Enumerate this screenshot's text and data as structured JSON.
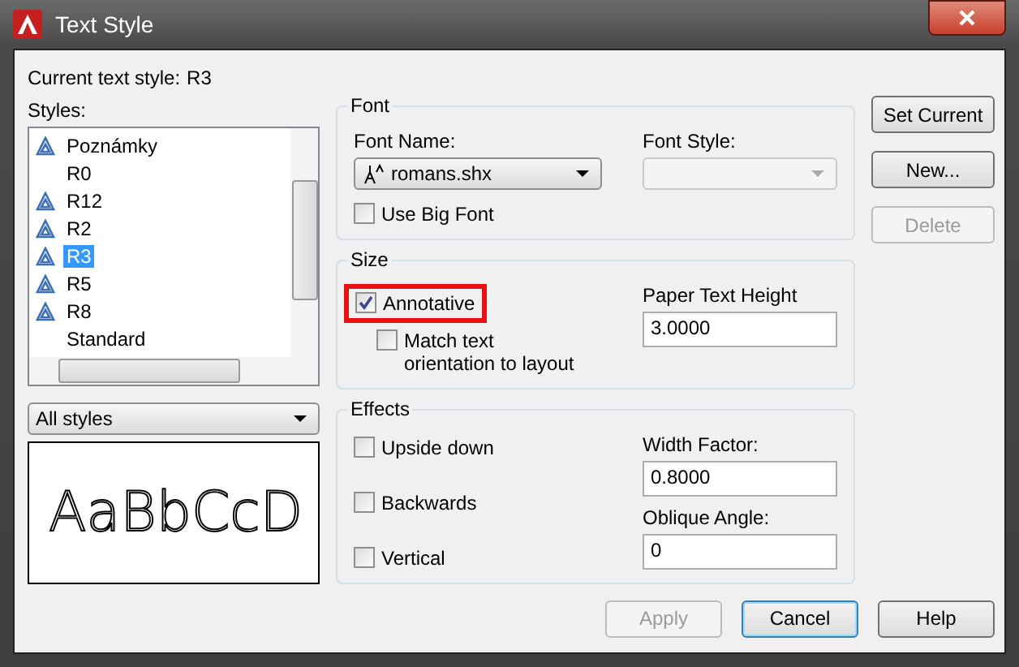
{
  "window": {
    "title": "Text Style"
  },
  "current_style": {
    "label": "Current text style:",
    "value": "R3"
  },
  "styles": {
    "label": "Styles:",
    "items": [
      {
        "name": "Poznámky",
        "annotative": true,
        "selected": false
      },
      {
        "name": "R0",
        "annotative": false,
        "selected": false
      },
      {
        "name": "R12",
        "annotative": true,
        "selected": false
      },
      {
        "name": "R2",
        "annotative": true,
        "selected": false
      },
      {
        "name": "R3",
        "annotative": true,
        "selected": true
      },
      {
        "name": "R5",
        "annotative": true,
        "selected": false
      },
      {
        "name": "R8",
        "annotative": true,
        "selected": false
      },
      {
        "name": "Standard",
        "annotative": false,
        "selected": false
      }
    ]
  },
  "filter": {
    "value": "All styles"
  },
  "preview": {
    "text": "AaBbCcD"
  },
  "font": {
    "title": "Font",
    "font_name": {
      "label": "Font Name:",
      "value": "romans.shx"
    },
    "font_style": {
      "label": "Font Style:",
      "disabled": true
    },
    "big_font": {
      "label": "Use Big Font",
      "checked": false
    }
  },
  "size": {
    "title": "Size",
    "annotative": {
      "label": "Annotative",
      "checked": true,
      "highlighted": true
    },
    "match": {
      "label": "Match text orientation to layout",
      "checked": false
    },
    "height": {
      "label": "Paper Text Height",
      "value": "3.0000"
    }
  },
  "effects": {
    "title": "Effects",
    "checks": [
      {
        "label": "Upside down",
        "checked": false
      },
      {
        "label": "Backwards",
        "checked": false
      },
      {
        "label": "Vertical",
        "checked": false
      }
    ],
    "width_factor": {
      "label": "Width Factor:",
      "value": "0.8000"
    },
    "oblique": {
      "label": "Oblique Angle:",
      "value": "0"
    }
  },
  "side_buttons": [
    {
      "label": "Set Current",
      "disabled": false
    },
    {
      "label": "New...",
      "disabled": false
    },
    {
      "label": "Delete",
      "disabled": true
    }
  ],
  "bottom_buttons": [
    {
      "label": "Apply",
      "disabled": true,
      "default": false
    },
    {
      "label": "Cancel",
      "disabled": false,
      "default": true
    },
    {
      "label": "Help",
      "disabled": false,
      "default": false
    }
  ]
}
